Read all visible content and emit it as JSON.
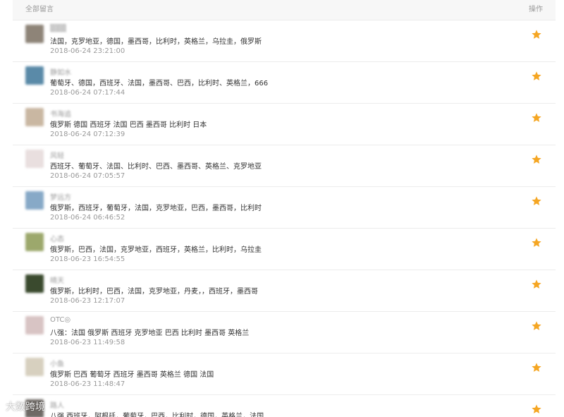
{
  "header": {
    "title": "全部留言",
    "action": "操作"
  },
  "comments": [
    {
      "avatar_color": "#8e8478",
      "user": "▒▒▒",
      "content": "法国，克罗地亚，德国，墨西哥，比利时，英格兰，乌拉圭，俄罗斯",
      "time": "2018-06-24 23:21:00"
    },
    {
      "avatar_color": "#5a8aa8",
      "user": "静如水",
      "content": "葡萄牙、德国，西班牙、法国，墨西哥、巴西，比利时、英格兰，666",
      "time": "2018-06-24 07:17:44"
    },
    {
      "avatar_color": "#c9b7a2",
      "user": "书海追",
      "content": "俄罗斯 德国 西班牙 法国 巴西 墨西哥 比利时 日本",
      "time": "2018-06-24 07:12:39"
    },
    {
      "avatar_color": "#e9dfdf",
      "user": "风轻",
      "content": "西班牙、葡萄牙、法国、比利时、巴西、墨西哥、英格兰、克罗地亚",
      "time": "2018-06-24 07:05:57"
    },
    {
      "avatar_color": "#87a9c7",
      "user": "梦远方",
      "content": "俄罗斯，西班牙，葡萄牙，法国，克罗地亚，巴西，墨西哥，比利时",
      "time": "2018-06-24 06:46:52"
    },
    {
      "avatar_color": "#9ca86c",
      "user": "心态",
      "content": "俄罗斯，巴西，法国，克罗地亚，西班牙，英格兰，比利时，乌拉圭",
      "time": "2018-06-23 16:54:55"
    },
    {
      "avatar_color": "#3a4a2e",
      "user": "晴天",
      "content": "俄罗斯，比利时，巴西，法国，克罗地亚，丹麦，，西班牙，墨西哥",
      "time": "2018-06-23 12:17:07"
    },
    {
      "avatar_color": "#d8c4c4",
      "user": "OTC◎",
      "user_clear": true,
      "content": "八强：法国 俄罗斯 西班牙 克罗地亚 巴西 比利时 墨西哥 英格兰",
      "time": "2018-06-23 11:49:58"
    },
    {
      "avatar_color": "#d7d0bf",
      "user": "小鱼",
      "content": "俄罗斯 巴西 葡萄牙 西班牙 墨西哥 英格兰 德国 法国",
      "time": "2018-06-23 11:48:47"
    },
    {
      "avatar_color": "#6f6a66",
      "user": "路人",
      "content": "八强 西班牙，阿根廷，葡萄牙，巴西，比利时，德国，英格兰，法国",
      "time": ""
    }
  ],
  "colors": {
    "star": "#f5a623",
    "border": "#ececec",
    "header_bg": "#f7f7f7"
  },
  "icons": {
    "action": "star-icon"
  },
  "watermark": "大数跨境"
}
